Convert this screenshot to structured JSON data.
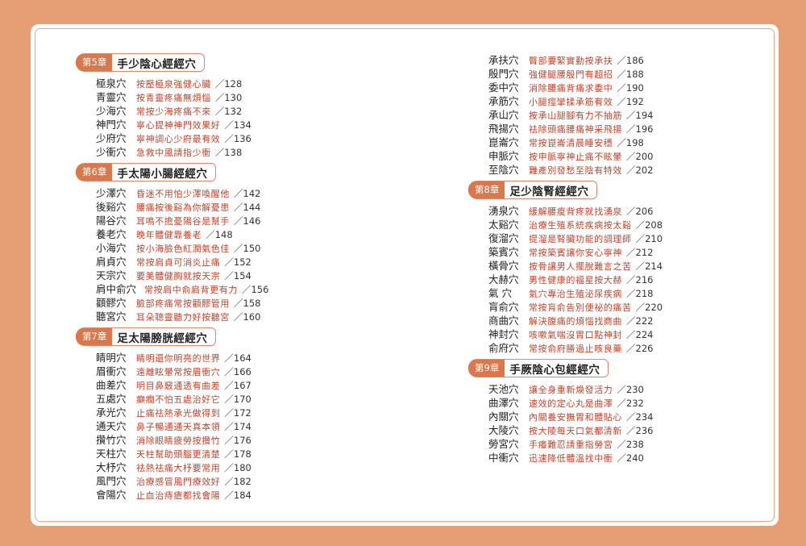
{
  "left_column": [
    {
      "chapter": "第5章",
      "title": "手少陰心經經穴",
      "entries": [
        {
          "name": "極泉穴",
          "desc": "按壓極泉強健心臟",
          "page": "／128"
        },
        {
          "name": "青靈穴",
          "desc": "按青靈疼痛無煩惱",
          "page": "／130"
        },
        {
          "name": "少海穴",
          "desc": "常按少海疼痛不來",
          "page": "／132"
        },
        {
          "name": "神門穴",
          "desc": "寧心提神神門效果好",
          "page": "／134"
        },
        {
          "name": "少府穴",
          "desc": "寧神調心少府最有效",
          "page": "／136"
        },
        {
          "name": "少衝穴",
          "desc": "急救中風請指少衝",
          "page": "／138"
        }
      ]
    },
    {
      "chapter": "第6章",
      "title": "手太陽小腸經經穴",
      "entries": [
        {
          "name": "少澤穴",
          "desc": "昏迷不用怕少澤喚醒他",
          "page": "／142"
        },
        {
          "name": "後谿穴",
          "desc": "腰痛按後谿為你解憂患",
          "page": "／144"
        },
        {
          "name": "陽谷穴",
          "desc": "耳鳴不擔憂陽谷是幫手",
          "page": "／146"
        },
        {
          "name": "養老穴",
          "desc": "晚年體健靠養老",
          "page": "／148"
        },
        {
          "name": "小海穴",
          "desc": "按小海臉色紅潤氣色佳",
          "page": "／150"
        },
        {
          "name": "肩貞穴",
          "desc": "常按肩貞可消炎止痛",
          "page": "／152"
        },
        {
          "name": "天宗穴",
          "desc": "要美體健胸就按天宗",
          "page": "／154"
        },
        {
          "name": "肩中俞穴",
          "desc": "常按肩中俞肩背更有力",
          "page": "／156"
        },
        {
          "name": "顴髎穴",
          "desc": "臉部疼痛常按顴髎管用",
          "page": "／158"
        },
        {
          "name": "聽宮穴",
          "desc": "耳朵聰靈聽力好按聽宮",
          "page": "／160"
        }
      ]
    },
    {
      "chapter": "第7章",
      "title": "足太陽膀胱經經穴",
      "entries": [
        {
          "name": "睛明穴",
          "desc": "睛明還你明亮的世界",
          "page": "／164"
        },
        {
          "name": "眉衝穴",
          "desc": "遠離眩暈常按眉衝穴",
          "page": "／166"
        },
        {
          "name": "曲差穴",
          "desc": "明目鼻竅通透有曲差",
          "page": "／167"
        },
        {
          "name": "五處穴",
          "desc": "癲癇不怕五處治好它",
          "page": "／170"
        },
        {
          "name": "承光穴",
          "desc": "止痛祛熱承光做得到",
          "page": "／172"
        },
        {
          "name": "通天穴",
          "desc": "鼻子暢通通天真本領",
          "page": "／174"
        },
        {
          "name": "攢竹穴",
          "desc": "消除眼睛疲勞按攢竹",
          "page": "／176"
        },
        {
          "name": "天柱穴",
          "desc": "天柱幫助頭腦更清楚",
          "page": "／178"
        },
        {
          "name": "大杼穴",
          "desc": "祛熱祛痛大杼要常用",
          "page": "／180"
        },
        {
          "name": "風門穴",
          "desc": "治療感冒風門療效好",
          "page": "／182"
        },
        {
          "name": "會陽穴",
          "desc": "止血治痔瘡都找會陽",
          "page": "／184"
        }
      ]
    }
  ],
  "right_column": [
    {
      "chapter": "",
      "title": "",
      "entries": [
        {
          "name": "承扶穴",
          "desc": "臀部要緊實勤按承扶",
          "page": "／186"
        },
        {
          "name": "殷門穴",
          "desc": "強健腿腰殷門有超招",
          "page": "／188"
        },
        {
          "name": "委中穴",
          "desc": "消除腰痛背痛求委中",
          "page": "／190"
        },
        {
          "name": "承筋穴",
          "desc": "小腿痙攣揉承筋有效",
          "page": "／192"
        },
        {
          "name": "承山穴",
          "desc": "按承山腿腳有力不抽筋",
          "page": "／194"
        },
        {
          "name": "飛揚穴",
          "desc": "祛除頭痛腰痛神采飛揚",
          "page": "／196"
        },
        {
          "name": "崑崙穴",
          "desc": "常按崑崙清晨睡安穩",
          "page": "／198"
        },
        {
          "name": "申脈穴",
          "desc": "按申脈寧神止痛不眩暈",
          "page": "／200"
        },
        {
          "name": "至陰穴",
          "desc": "難產別發愁至陰有特效",
          "page": "／202"
        }
      ]
    },
    {
      "chapter": "第8章",
      "title": "足少陰腎經經穴",
      "entries": [
        {
          "name": "湧泉穴",
          "desc": "緩解腰痠背疼就找湧泉",
          "page": "／206"
        },
        {
          "name": "太谿穴",
          "desc": "治療生殖系統疾病按太谿",
          "page": "／208"
        },
        {
          "name": "復溜穴",
          "desc": "提溜是腎臟功能的調理師",
          "page": "／210"
        },
        {
          "name": "築賓穴",
          "desc": "常按築賓讓你安心寧神",
          "page": "／212"
        },
        {
          "name": "橫骨穴",
          "desc": "按骨讓男人擺脫難言之苦",
          "page": "／214"
        },
        {
          "name": "大赫穴",
          "desc": "男性健康的福星按大赫",
          "page": "／216"
        },
        {
          "name": "氣 穴",
          "desc": "氣穴專治生殖泌尿疾病",
          "page": "／218"
        },
        {
          "name": "肓俞穴",
          "desc": "常按肓俞告別便祕的痛苦",
          "page": "／220"
        },
        {
          "name": "商曲穴",
          "desc": "解決腹痛的煩惱找商曲",
          "page": "／222"
        },
        {
          "name": "神封穴",
          "desc": "咳嗽氣喘沒胃口點神封",
          "page": "／224"
        },
        {
          "name": "俞府穴",
          "desc": "常按俞府勝過止咳良藥",
          "page": "／226"
        }
      ]
    },
    {
      "chapter": "第9章",
      "title": "手厥陰心包經經穴",
      "entries": [
        {
          "name": "天池穴",
          "desc": "讓全身重新煥發活力",
          "page": "／230"
        },
        {
          "name": "曲澤穴",
          "desc": "速效的定心丸是曲澤",
          "page": "／232"
        },
        {
          "name": "內關穴",
          "desc": "內關養安撫胃和體貼心",
          "page": "／234"
        },
        {
          "name": "大陵穴",
          "desc": "按大陵每天口氣都清新",
          "page": "／236"
        },
        {
          "name": "勞宮穴",
          "desc": "手癢難忍請重指勞宮",
          "page": "／238"
        },
        {
          "name": "中衝穴",
          "desc": "迅速降低體溫找中衝",
          "page": "／240"
        }
      ]
    }
  ]
}
